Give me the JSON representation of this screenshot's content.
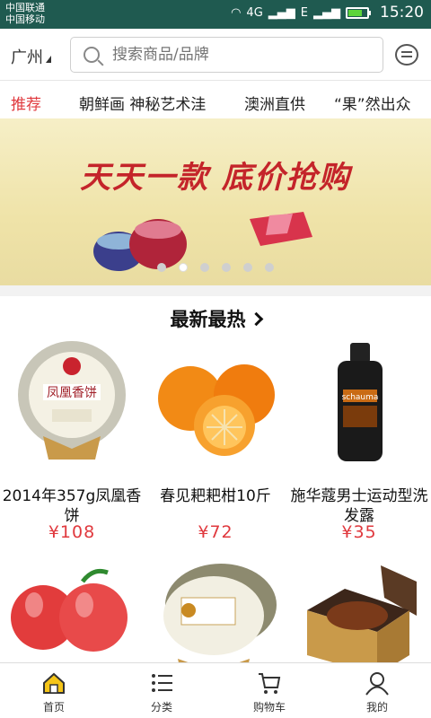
{
  "status_bar": {
    "carrier1": "中国联通",
    "carrier2": "中国移动",
    "network": "4G",
    "signal2": "E",
    "time": "15:20"
  },
  "header": {
    "city": "广州",
    "search_placeholder": "搜索商品/品牌"
  },
  "tabs": [
    {
      "label": "推荐",
      "active": true
    },
    {
      "label": "朝鲜画 神秘艺术洼",
      "active": false
    },
    {
      "label": "澳洲直供",
      "active": false
    },
    {
      "label": "“果”然出众",
      "active": false
    }
  ],
  "banner": {
    "title": "天天一款   底价抢购",
    "slides": 6,
    "active_slide": 2
  },
  "section": {
    "title": "最新最热"
  },
  "products": [
    {
      "name": "2014年357g凤凰香饼",
      "price": "¥108",
      "icon": "tea-cake-image"
    },
    {
      "name": "春见耙耙柑10斤",
      "price": "¥72",
      "icon": "orange-image"
    },
    {
      "name": "施华蔻男士运动型洗发露",
      "price": "¥35",
      "icon": "shampoo-image"
    },
    {
      "name": "",
      "price": "",
      "icon": "apple-image"
    },
    {
      "name": "",
      "price": "",
      "icon": "tea-cake-image"
    },
    {
      "name": "",
      "price": "",
      "icon": "gift-box-image"
    }
  ],
  "bottom_nav": [
    {
      "label": "首页",
      "icon": "home-icon",
      "active": true
    },
    {
      "label": "分类",
      "icon": "list-icon",
      "active": false
    },
    {
      "label": "购物车",
      "icon": "cart-icon",
      "active": false
    },
    {
      "label": "我的",
      "icon": "user-icon",
      "active": false
    }
  ],
  "colors": {
    "accent": "#e0393e",
    "status_bar": "#1f5a50",
    "banner_bg": "#f1e6b0"
  }
}
